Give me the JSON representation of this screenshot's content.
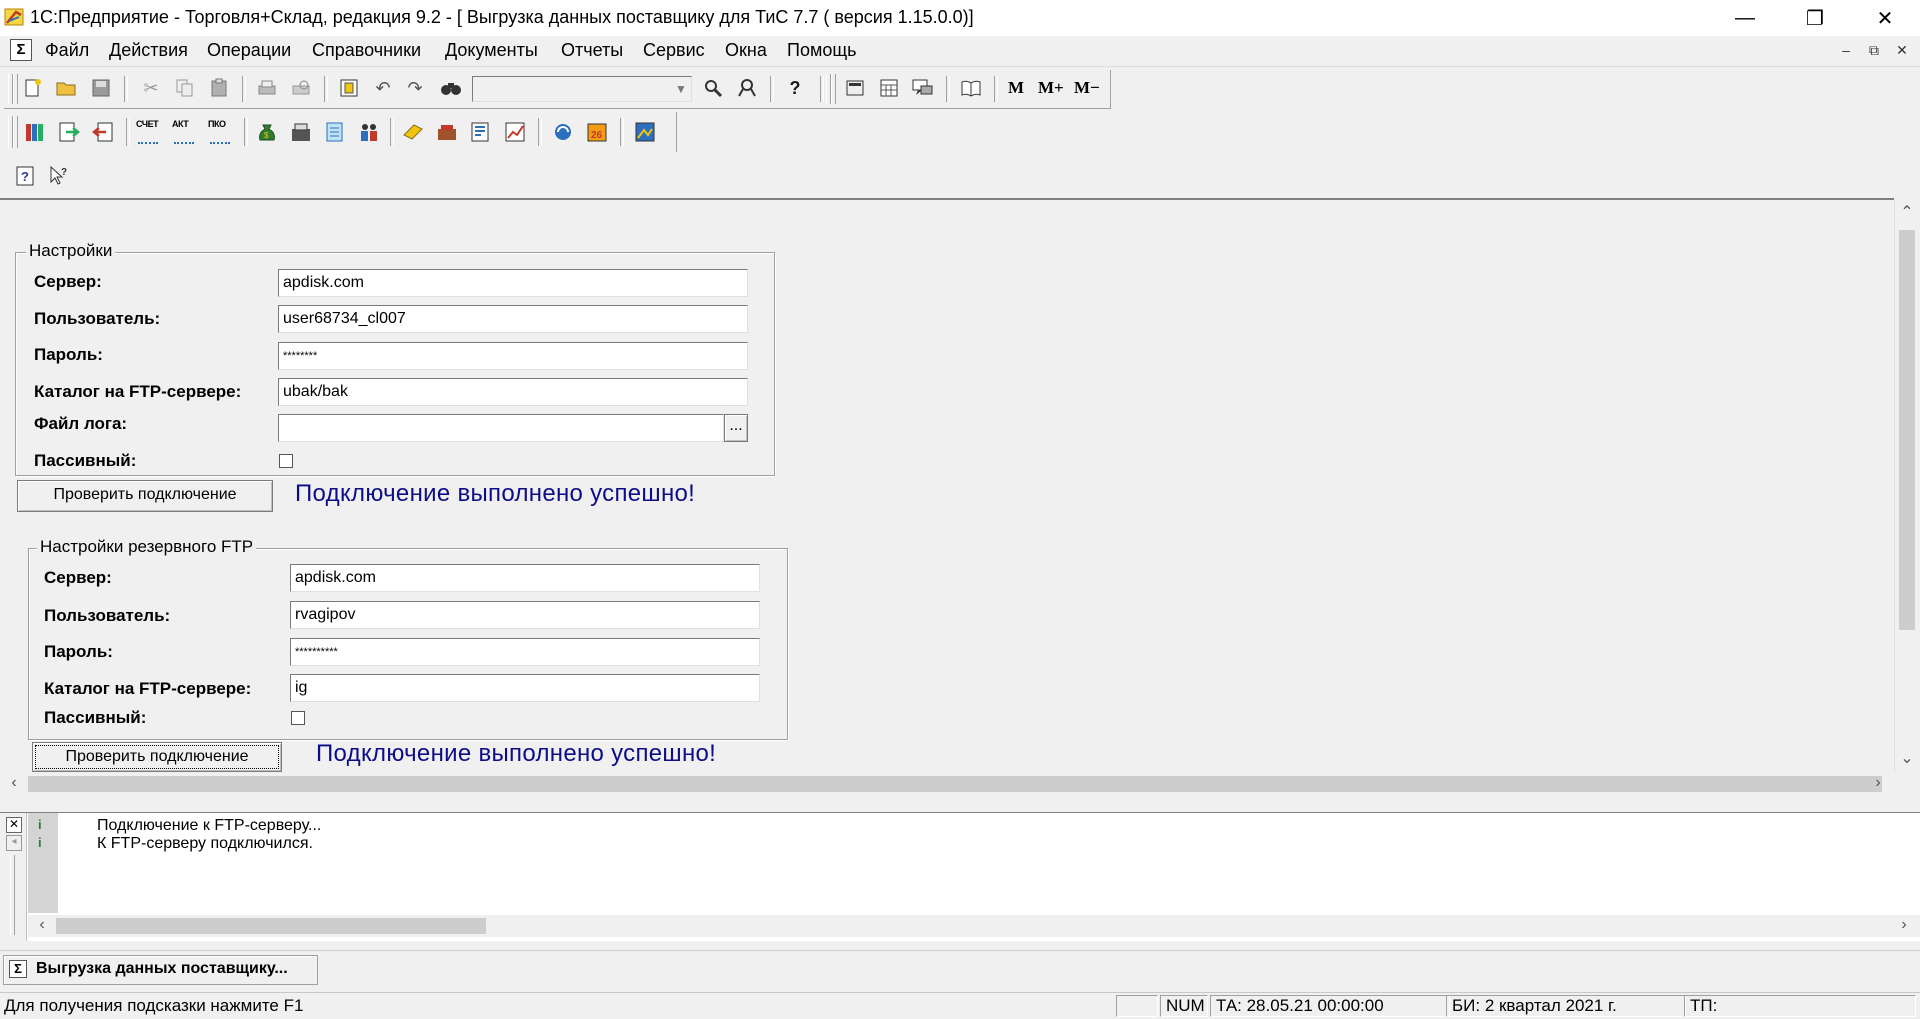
{
  "window": {
    "title": "1С:Предприятие - Торговля+Склад, редакция 9.2 - [ Выгрузка данных поставщику для ТиС 7.7 ( версия 1.15.0.0)]",
    "minimize_glyph": "—",
    "restore_glyph": "❐",
    "close_glyph": "✕"
  },
  "menu": {
    "items": [
      "Файл",
      "Действия",
      "Операции",
      "Справочники",
      "Документы",
      "Отчеты",
      "Сервис",
      "Окна",
      "Помощь"
    ],
    "mdi_minimize": "–",
    "mdi_restore": "⧉",
    "mdi_close": "✕"
  },
  "toolbar1": {
    "memory_buttons": [
      "M",
      "M+",
      "M−"
    ]
  },
  "toolbar2": {
    "doc_buttons": [
      "СЧЕТ",
      "АКТ",
      "ПКО"
    ]
  },
  "settings": {
    "group_title": "Настройки",
    "server_label": "Сервер:",
    "server_value": "apdisk.com",
    "user_label": "Пользователь:",
    "user_value": "user68734_cl007",
    "password_label": "Пароль:",
    "password_value": "********",
    "catalog_label": "Каталог на FTP-сервере:",
    "catalog_value": "ubak/bak",
    "logfile_label": "Файл лога:",
    "logfile_value": "",
    "browse_label": "...",
    "passive_label": "Пассивный:",
    "check_button": "Проверить подключение",
    "status_message": "Подключение выполнено успешно!"
  },
  "backup": {
    "group_title": "Настройки резервного FTP",
    "server_label": "Сервер:",
    "server_value": "apdisk.com",
    "user_label": "Пользователь:",
    "user_value": "rvagipov",
    "password_label": "Пароль:",
    "password_value": "**********",
    "catalog_label": "Каталог на FTP-сервере:",
    "catalog_value": "ig",
    "passive_label": "Пассивный:",
    "check_button": "Проверить подключение",
    "status_message": "Подключение выполнено успешно!"
  },
  "messages": [
    "Подключение к FTP-серверу...",
    "К FTP-серверу подключился."
  ],
  "taskbar": {
    "tab_label": "Выгрузка данных поставщику..."
  },
  "status": {
    "hint": "Для получения подсказки нажмите F1",
    "num": "NUM",
    "ta": "ТА: 28.05.21  00:00:00",
    "bi": "БИ: 2 квартал 2021 г.",
    "tp": "ТП:"
  }
}
